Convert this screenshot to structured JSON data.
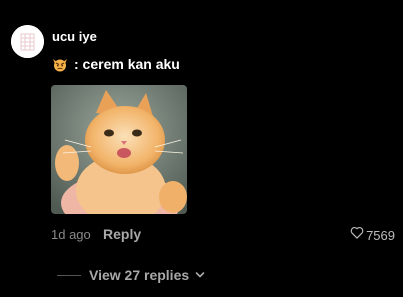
{
  "comment": {
    "username": "ucu iye",
    "text": ": cerem kan aku",
    "emoji_icon": "pouting-cat-emoji",
    "image_icon": "cat-photo",
    "timestamp": "1d ago",
    "reply_label": "Reply",
    "like_count": "7569"
  },
  "replies": {
    "view_label": "View 27 replies"
  },
  "colors": {
    "background": "#000000",
    "text_primary": "#ffffff",
    "text_muted": "#8a8a8a"
  }
}
